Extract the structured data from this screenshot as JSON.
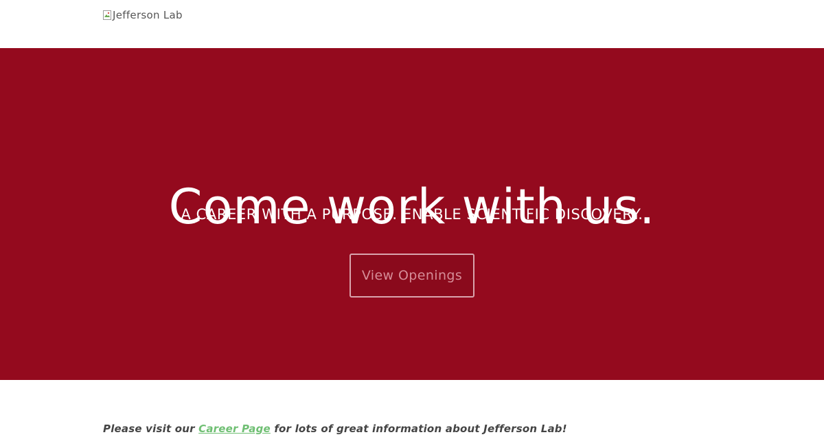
{
  "header": {
    "logo_alt": "Jefferson Lab"
  },
  "hero": {
    "title": "Come work with us.",
    "subtitle": "A CAREER WITH A PURPOSE. ENABLE SCIENTIFIC DISCOVERY.",
    "cta_label": "View Openings"
  },
  "footer": {
    "prefix": "Please visit our ",
    "link_label": "Career Page",
    "suffix": " for lots of great information about Jefferson Lab!"
  },
  "colors": {
    "hero_background": "#940a1e",
    "link": "#6fbf73",
    "text": "#444444"
  },
  "icons": {
    "logo": "broken-image-icon"
  }
}
